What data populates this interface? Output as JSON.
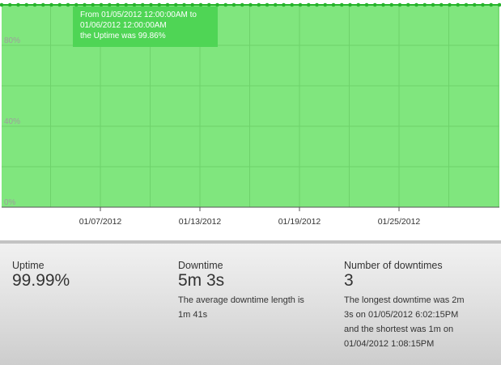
{
  "chart_data": {
    "type": "area",
    "ylim": [
      0,
      100
    ],
    "yticks": [
      "0%",
      "40%",
      "80%"
    ],
    "xticks": [
      "01/07/2012",
      "01/13/2012",
      "01/19/2012",
      "01/25/2012"
    ],
    "series": [
      {
        "values": [
          100,
          100,
          100,
          100,
          100,
          100,
          100,
          100,
          100,
          100,
          100,
          100,
          100,
          100,
          100,
          100,
          100,
          100,
          100,
          100,
          100,
          100,
          100,
          100,
          100,
          100,
          100,
          100,
          100,
          100,
          100,
          100,
          100,
          100,
          100,
          100,
          100,
          100,
          100,
          100,
          100,
          100,
          100,
          100,
          100,
          100,
          100,
          100,
          100,
          100,
          100,
          100,
          100,
          100,
          100,
          100,
          100,
          100,
          100,
          100,
          100
        ]
      }
    ],
    "colors": {
      "fill": "#80e67e",
      "line": "#27b42c",
      "grid": "#6ed26b",
      "tooltip": "#4fd555"
    },
    "grid": true,
    "tooltip": {
      "line1": "From 01/05/2012 12:00:00AM to",
      "line2": "01/06/2012 12:00:00AM",
      "line3": "the Uptime was 99.86%"
    }
  },
  "stats": {
    "uptime": {
      "label": "Uptime",
      "value": "99.99%"
    },
    "downtime": {
      "label": "Downtime",
      "value": "5m 3s",
      "desc": [
        "The average downtime length is",
        "1m 41s"
      ]
    },
    "downtimes": {
      "label": "Number of downtimes",
      "value": "3",
      "desc": [
        "The longest downtime was 2m",
        "3s on 01/05/2012 6:02:15PM",
        "and the shortest was 1m on",
        "01/04/2012 1:08:15PM"
      ]
    }
  }
}
